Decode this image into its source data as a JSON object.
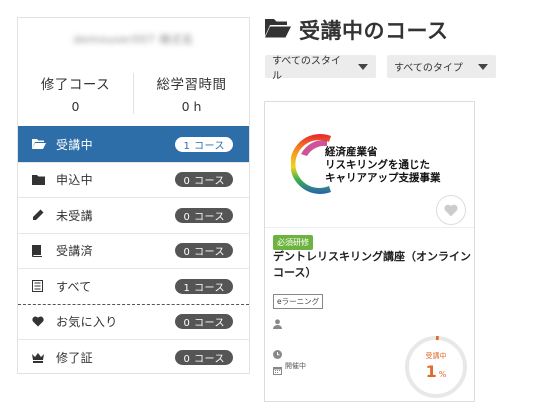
{
  "user": {
    "name": "demouser007 様式名"
  },
  "stats": [
    {
      "label": "修了コース",
      "value": "0"
    },
    {
      "label": "総学習時間",
      "value": "0 h"
    }
  ],
  "nav": [
    {
      "icon": "folder-open-icon",
      "label": "受講中",
      "count": "1 コース",
      "active": true
    },
    {
      "icon": "folder-icon",
      "label": "申込中",
      "count": "0 コース"
    },
    {
      "icon": "pencil-icon",
      "label": "未受講",
      "count": "0 コース"
    },
    {
      "icon": "book-icon",
      "label": "受講済",
      "count": "0 コース"
    },
    {
      "icon": "list-icon",
      "label": "すべて",
      "count": "1 コース"
    },
    {
      "icon": "heart-icon",
      "label": "お気に入り",
      "count": "0 コース"
    },
    {
      "icon": "crown-icon",
      "label": "修了証",
      "count": "0 コース"
    }
  ],
  "main": {
    "title": "受講中のコース",
    "title_icon": "folder-open-icon",
    "filters": {
      "style": "すべてのスタイル",
      "type": "すべてのタイプ"
    }
  },
  "course": {
    "logo_lines": [
      "経済産業省",
      "リスキリングを通じた",
      "キャリアアップ支援事業"
    ],
    "required_label": "必須研修",
    "title": "デントレリスキリング講座（オンラインコース）",
    "tag": "eラーニング",
    "status": "開催中",
    "progress_label": "受講中",
    "progress_value": "1",
    "progress_unit": "%",
    "progress_percent": 1
  },
  "colors": {
    "accent": "#2d6ea8",
    "badge": "#555555",
    "required": "#6db33f",
    "progress": "#e06a2a"
  }
}
